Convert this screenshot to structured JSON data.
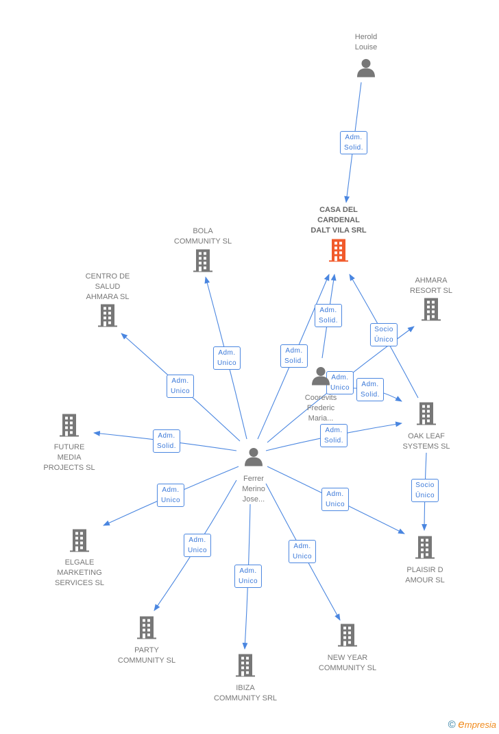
{
  "colors": {
    "edge": "#4a86e0",
    "building": "#777777",
    "main_building": "#f15a2b",
    "person": "#777777"
  },
  "nodes": [
    {
      "id": "herold",
      "type": "person-icon",
      "label": "Herold\nLouise"
    },
    {
      "id": "casa",
      "type": "main-building-icon",
      "label": "CASA DEL\nCARDENAL\nDALT VILA SRL"
    },
    {
      "id": "bola",
      "type": "building-icon",
      "label": "BOLA\nCOMMUNITY SL"
    },
    {
      "id": "centro",
      "type": "building-icon",
      "label": "CENTRO DE\nSALUD\nAHMARA SL"
    },
    {
      "id": "ahmara",
      "type": "building-icon",
      "label": "AHMARA\nRESORT SL"
    },
    {
      "id": "future",
      "type": "building-icon",
      "label": "FUTURE\nMEDIA\nPROJECTS SL"
    },
    {
      "id": "coorevits",
      "type": "person-icon",
      "label": "Coorevits\nFrederic\nMaria..."
    },
    {
      "id": "ferrer",
      "type": "person-icon",
      "label": "Ferrer\nMerino\nJose..."
    },
    {
      "id": "oak",
      "type": "building-icon",
      "label": "OAK LEAF\nSYSTEMS SL"
    },
    {
      "id": "elgale",
      "type": "building-icon",
      "label": "ELGALE\nMARKETING\nSERVICES SL"
    },
    {
      "id": "plaisir",
      "type": "building-icon",
      "label": "PLAISIR D\nAMOUR SL"
    },
    {
      "id": "party",
      "type": "building-icon",
      "label": "PARTY\nCOMMUNITY SL"
    },
    {
      "id": "ibiza",
      "type": "building-icon",
      "label": "IBIZA\nCOMMUNITY SRL"
    },
    {
      "id": "newyear",
      "type": "building-icon",
      "label": "NEW YEAR\nCOMMUNITY SL"
    }
  ],
  "edges": [
    {
      "from": "herold",
      "to": "casa",
      "label": "Adm.\nSolid."
    },
    {
      "from": "ferrer",
      "to": "bola",
      "label": "Adm.\nUnico"
    },
    {
      "from": "ferrer",
      "to": "centro",
      "label": "Adm.\nUnico"
    },
    {
      "from": "ferrer",
      "to": "future",
      "label": "Adm.\nSolid."
    },
    {
      "from": "ferrer",
      "to": "elgale",
      "label": "Adm.\nUnico"
    },
    {
      "from": "ferrer",
      "to": "party",
      "label": "Adm.\nUnico"
    },
    {
      "from": "ferrer",
      "to": "ibiza",
      "label": "Adm.\nUnico"
    },
    {
      "from": "ferrer",
      "to": "newyear",
      "label": "Adm.\nUnico"
    },
    {
      "from": "ferrer",
      "to": "plaisir",
      "label": "Adm.\nUnico"
    },
    {
      "from": "ferrer",
      "to": "oak",
      "label": "Adm.\nSolid."
    },
    {
      "from": "ferrer",
      "to": "casa",
      "label": "Adm.\nSolid."
    },
    {
      "from": "ferrer",
      "to": "ahmara",
      "label": "Adm.\nUnico"
    },
    {
      "from": "oak",
      "to": "casa",
      "label": "Socio\nÚnico"
    },
    {
      "from": "coorevits",
      "to": "casa",
      "label": "Adm.\nSolid."
    },
    {
      "from": "coorevits",
      "to": "oak",
      "label": "Adm.\nSolid."
    },
    {
      "from": "oak",
      "to": "plaisir",
      "label": "Socio\nÚnico"
    }
  ],
  "footer": {
    "copyright": "©",
    "brand_initial": "e",
    "brand_rest": "mpresia"
  }
}
